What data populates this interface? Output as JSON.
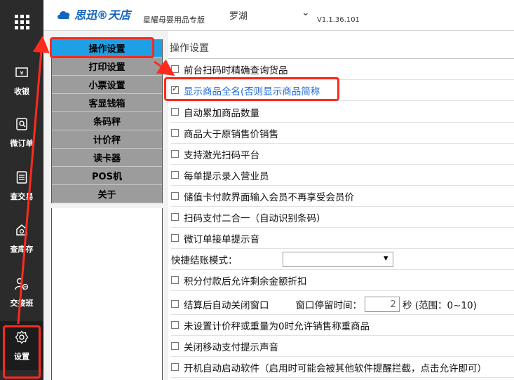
{
  "topbar": {
    "logo": "思迅®天店",
    "subtitle": "星耀母婴用品专版",
    "store": "罗湖",
    "version": "V1.1.36.101"
  },
  "rail": {
    "items": [
      {
        "label": "收银",
        "icon": "cash-register-icon"
      },
      {
        "label": "微订单",
        "icon": "order-icon"
      },
      {
        "label": "查交易",
        "icon": "receipt-icon"
      },
      {
        "label": "查库存",
        "icon": "home-icon"
      },
      {
        "label": "交接班",
        "icon": "user-switch-icon"
      },
      {
        "label": "设置",
        "icon": "gear-icon"
      }
    ]
  },
  "settings_nav": {
    "items": [
      {
        "label": "操作设置",
        "active": true
      },
      {
        "label": "打印设置"
      },
      {
        "label": "小票设置"
      },
      {
        "label": "客显钱箱"
      },
      {
        "label": "条码秤"
      },
      {
        "label": "计价秤"
      },
      {
        "label": "读卡器"
      },
      {
        "label": "POS机"
      },
      {
        "label": "关于"
      }
    ]
  },
  "content": {
    "title": "操作设置",
    "options": [
      {
        "label": "前台扫码时精确查询货品",
        "checked": false
      },
      {
        "label": "显示商品全名(否则显示商品简称",
        "checked": true
      },
      {
        "label": "自动累加商品数量",
        "checked": false
      },
      {
        "label": "商品大于原销售价销售",
        "checked": false
      },
      {
        "label": "支持激光扫码平台",
        "checked": false
      },
      {
        "label": "每单提示录入营业员",
        "checked": false
      },
      {
        "label": "储值卡付款界面输入会员不再享受会员价",
        "checked": false
      },
      {
        "label": "扫码支付二合一（自动识别条码）",
        "checked": false
      },
      {
        "label": "微订单接单提示音",
        "checked": false
      }
    ],
    "quick_checkout": {
      "label": "快捷结账模式：",
      "value": ""
    },
    "option_points": {
      "label": "积分付款后允许剩余金额折扣",
      "checked": false
    },
    "auto_close": {
      "label": "结算后自动关闭窗口",
      "stay_label": "窗口停留时间：",
      "stay_value": "2",
      "unit": "秒 (范围：0~10)",
      "checked": false
    },
    "options2": [
      {
        "label": "未设置计价秤或重量为0时允许销售称重商品",
        "checked": false
      },
      {
        "label": "关闭移动支付提示声音",
        "checked": false
      },
      {
        "label": "开机自动启动软件（启用时可能会被其他软件提醒拦截，点击允许即可）",
        "checked": false
      }
    ]
  },
  "colors": {
    "rail_bg": "#2b2b2b",
    "nav_active": "#1ea0e6",
    "nav_item": "#9c9c9c",
    "annotation_red": "#ff2a1e",
    "highlight_text": "#1e6bd6"
  }
}
